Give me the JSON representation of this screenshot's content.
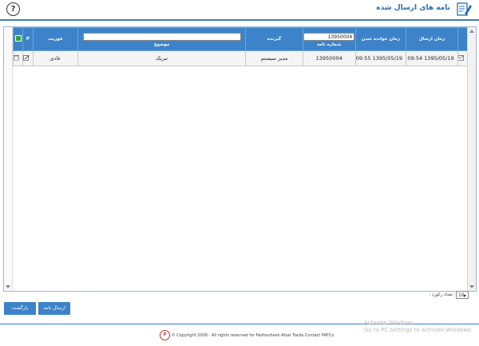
{
  "page": {
    "title": "نامه های ارسال شده",
    "help_symbol": "?"
  },
  "columns": {
    "send_time": "زمان ارسال",
    "read_time": "زمان خوانده شدن",
    "letter_number": "شماره نامه",
    "recipient": "گیرنده",
    "subject": "موضوع",
    "urgency": "فوریت",
    "pin_header": "P"
  },
  "filters": {
    "letter_number_value": "13950004",
    "subject_value": ""
  },
  "rows": [
    {
      "send_time": "1395/05/19 09:54",
      "read_time": "1395/05/19 09:55",
      "letter_number": "13950004",
      "recipient": "مدیر سیستم",
      "subject": "تبریک",
      "urgency": "عادی"
    }
  ],
  "pager": {
    "label": "تعداد رکورد :",
    "page_size": "10"
  },
  "buttons": {
    "back": "بازگشت",
    "send_letter": "ارسال نامه"
  },
  "footer": {
    "logo_text": "P",
    "copyright": "© Copyright 2009 - All rights reserved for Pazhouhesh Afzar Farda",
    "contact": "Contact PAFCo"
  },
  "watermark": {
    "line1": "Activate Windows",
    "line2": "Go to PC settings to activate Windows."
  },
  "icons": {
    "title": "edit-document-icon",
    "help": "help-icon",
    "envelope": "envelope-icon",
    "delete": "trash-icon",
    "edit": "edit-icon",
    "header_flag": "green-flag-icon"
  },
  "colors": {
    "header_blue": "#3d83c9",
    "title_blue": "#2b6cb0",
    "row_bg": "#f4f4f4"
  }
}
